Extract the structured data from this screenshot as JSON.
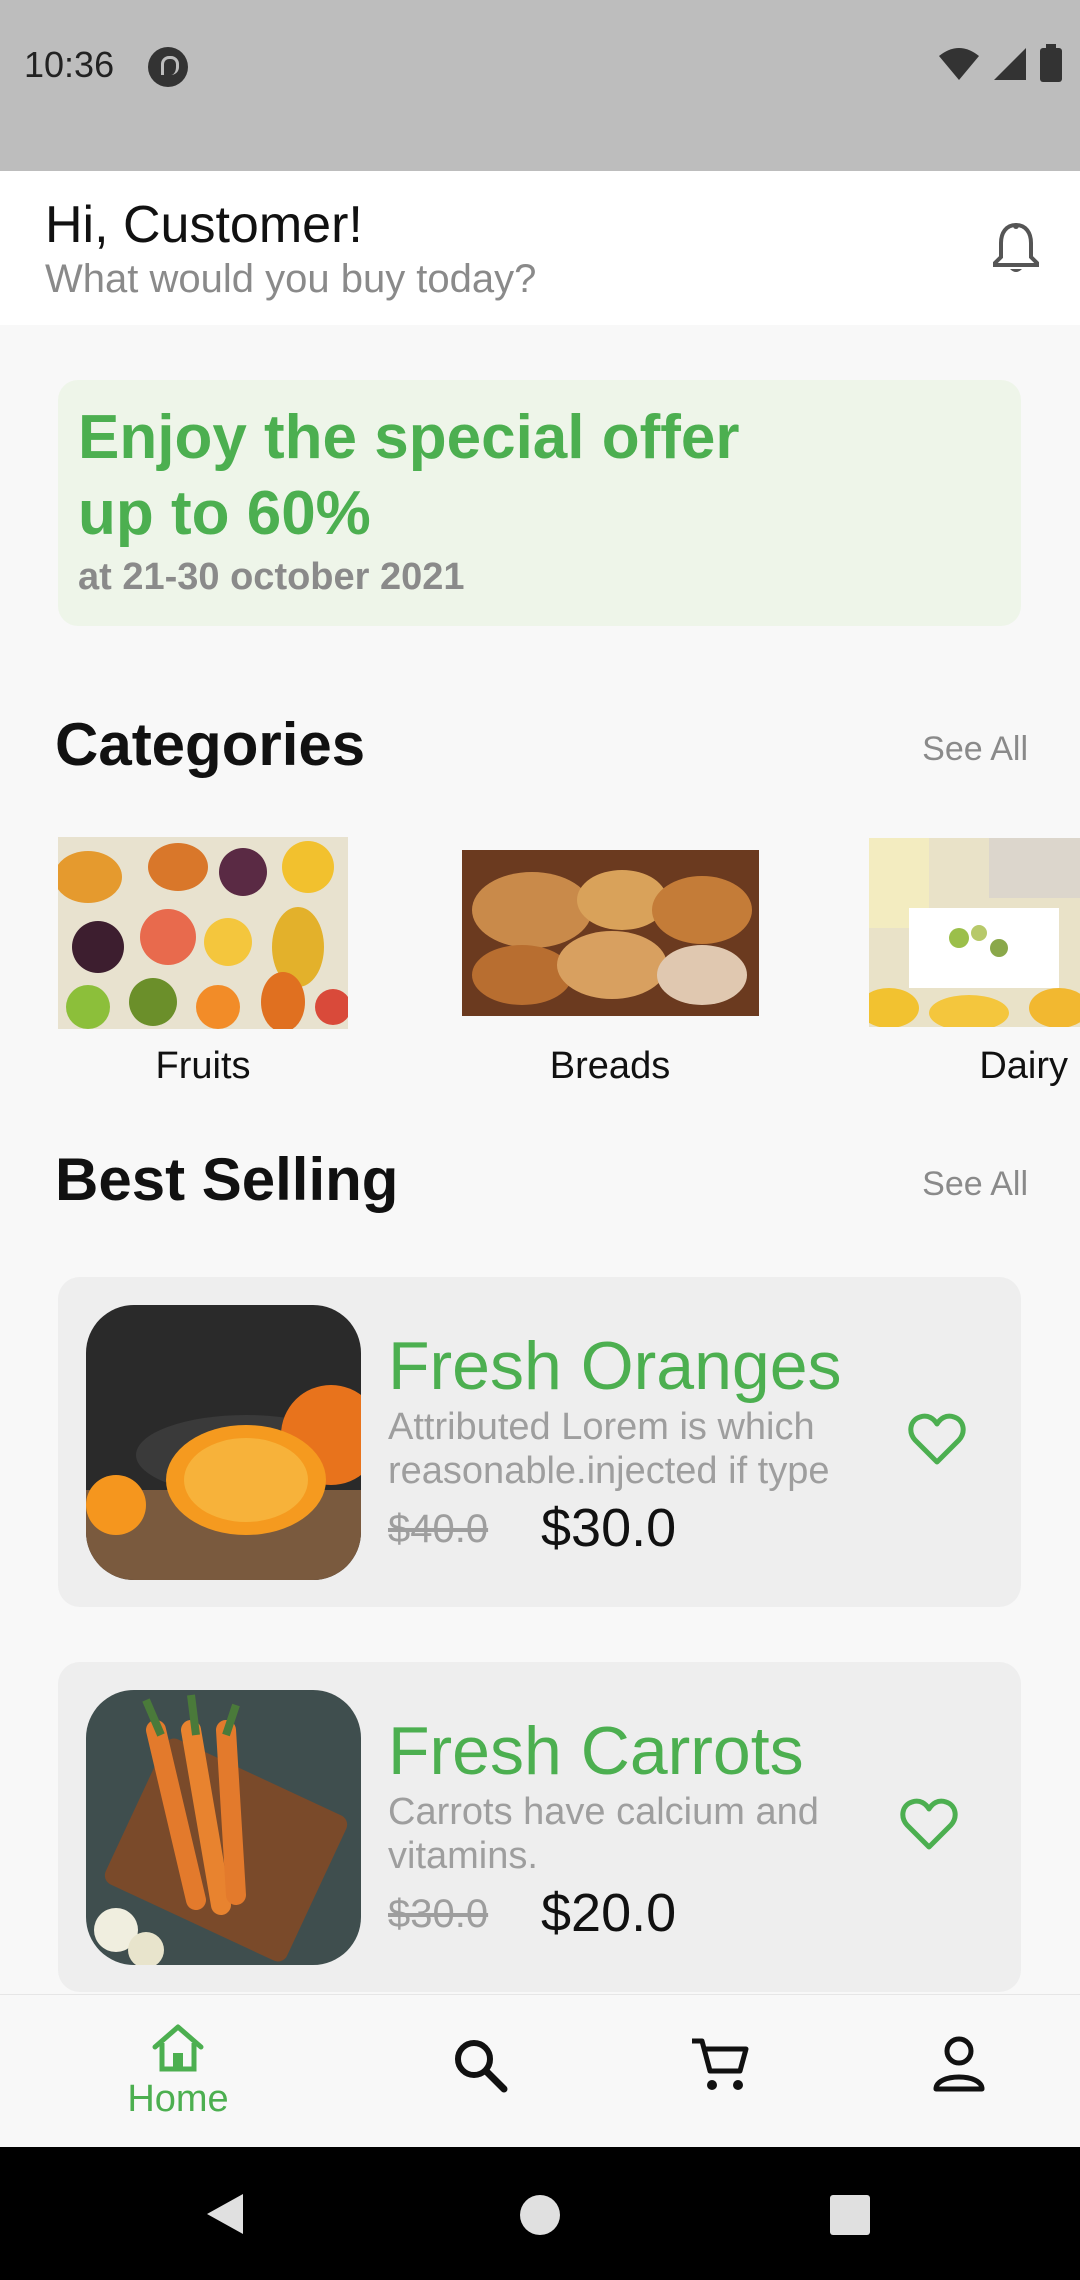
{
  "status": {
    "time": "10:36"
  },
  "header": {
    "greeting": "Hi, Customer!",
    "subtitle": "What would you buy today?"
  },
  "promo": {
    "title_line1": "Enjoy the special offer",
    "title_line2": "up to 60%",
    "date": "at 21-30 october 2021"
  },
  "categories": {
    "title": "Categories",
    "see_all": "See All",
    "items": [
      {
        "label": "Fruits"
      },
      {
        "label": "Breads"
      },
      {
        "label": "Dairy"
      }
    ]
  },
  "best_selling": {
    "title": "Best Selling",
    "see_all": "See All",
    "products": [
      {
        "name": "Fresh Oranges",
        "desc_line1": "Attributed Lorem is which",
        "desc_line2": "reasonable.injected if type",
        "old_price": "$40.0",
        "price": "$30.0"
      },
      {
        "name": "Fresh Carrots",
        "desc_line1": "Carrots have calcium and",
        "desc_line2": "vitamins.",
        "old_price": "$30.0",
        "price": "$20.0"
      }
    ]
  },
  "nav": {
    "home_label": "Home",
    "items": [
      "home-icon",
      "search-icon",
      "cart-icon",
      "profile-icon"
    ]
  },
  "colors": {
    "accent": "#4caf50",
    "promo_bg": "#eef5e9",
    "card_bg": "#eeeeee"
  }
}
